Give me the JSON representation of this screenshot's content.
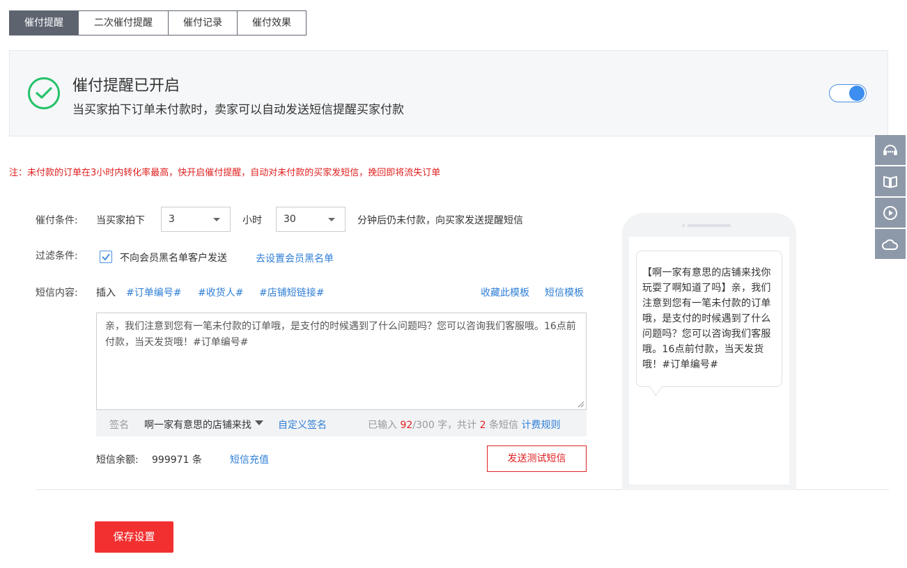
{
  "tabs": [
    {
      "label": "催付提醒",
      "active": true
    },
    {
      "label": "二次催付提醒",
      "active": false
    },
    {
      "label": "催付记录",
      "active": false
    },
    {
      "label": "催付效果",
      "active": false
    }
  ],
  "status": {
    "title": "催付提醒已开启",
    "description": "当买家拍下订单未付款时，卖家可以自动发送短信提醒买家付款",
    "enabled": true
  },
  "notice": "注：未付款的订单在3小时内转化率最高，快开启催付提醒，自动对未付款的买家发短信，挽回即将流失订单",
  "condition": {
    "label": "催付条件:",
    "prefix": "当买家拍下",
    "hours_value": "3",
    "hours_unit": "小时",
    "minutes_value": "30",
    "suffix": "分钟后仍未付款，向买家发送提醒短信"
  },
  "filter": {
    "label": "过滤条件:",
    "checkbox_label": "不向会员黑名单客户发送",
    "checked": true,
    "link": "去设置会员黑名单"
  },
  "sms": {
    "label": "短信内容:",
    "insert_label": "插入",
    "tags": [
      "#订单编号#",
      "#收货人#",
      "#店铺短链接#"
    ],
    "save_template": "收藏此模板",
    "templates": "短信模板",
    "content": "亲，我们注意到您有一笔未付款的订单哦，是支付的时候遇到了什么问题吗？您可以咨询我们客服哦。16点前付款，当天发货哦！#订单编号#"
  },
  "signature": {
    "label": "签名",
    "value": "啊一家有意思的店铺来找",
    "custom_link": "自定义签名",
    "count_prefix": "已输入",
    "count_typed": "92",
    "count_max": "/300 字，共计",
    "count_sms": "2",
    "count_suffix": "条短信",
    "billing_link": "计费规则"
  },
  "balance": {
    "label": "短信余额:",
    "value": "999971 条",
    "recharge_link": "短信充值"
  },
  "buttons": {
    "send_test": "发送测试短信",
    "save": "保存设置"
  },
  "preview": {
    "text": "【啊一家有意思的店铺来找你玩耍了啊知道了吗】亲，我们注意到您有一笔未付款的订单哦，是支付的时候遇到了什么问题吗？您可以咨询我们客服哦。16点前付款，当天发货哦！#订单编号#"
  },
  "colors": {
    "accent_red": "#e02020",
    "link_blue": "#2f7fd6",
    "success_green": "#25c26a",
    "tab_active": "#5d6470"
  },
  "sidebar_icons": [
    "customer-service-icon",
    "book-icon",
    "play-icon",
    "cloud-icon"
  ]
}
